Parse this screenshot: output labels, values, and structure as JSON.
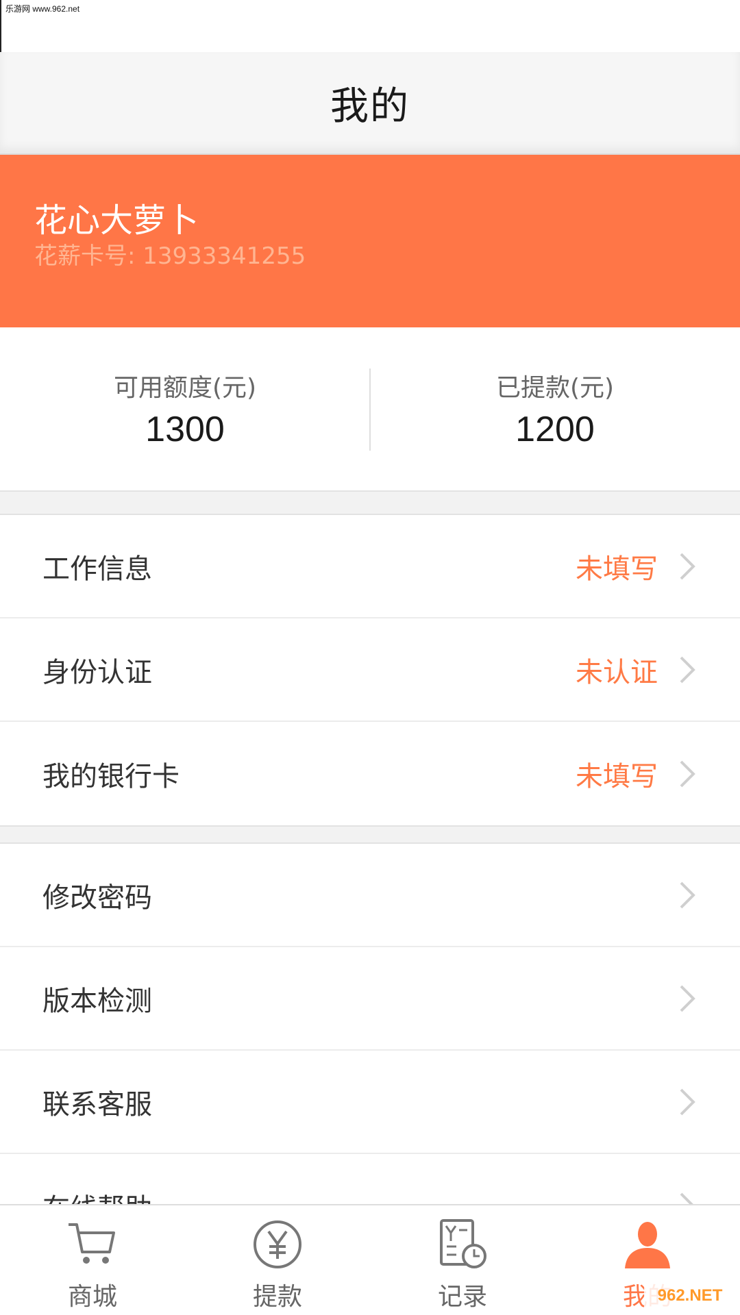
{
  "watermark": {
    "text": "乐游网 www.962.net"
  },
  "nav": {
    "title": "我的"
  },
  "profile": {
    "name": "花心大萝卜",
    "card": "花薪卡号: 13933341255"
  },
  "stats": [
    {
      "label": "可用额度(元)",
      "value": "1300"
    },
    {
      "label": "已提款(元)",
      "value": "1200"
    }
  ],
  "group1": [
    {
      "label": "工作信息",
      "status": "未填写"
    },
    {
      "label": "身份认证",
      "status": "未认证"
    },
    {
      "label": "我的银行卡",
      "status": "未填写"
    }
  ],
  "group2": [
    {
      "label": "修改密码"
    },
    {
      "label": "版本检测"
    },
    {
      "label": "联系客服"
    },
    {
      "label": "在线帮助"
    }
  ],
  "tabs": [
    {
      "label": "商城",
      "icon": "cart-icon"
    },
    {
      "label": "提款",
      "icon": "yen-icon"
    },
    {
      "label": "记录",
      "icon": "record-icon"
    },
    {
      "label": "我的",
      "icon": "user-icon",
      "active": true
    }
  ],
  "logo": {
    "text": "962.NET"
  },
  "colors": {
    "accent": "#ff7647",
    "status": "#ff7a45"
  }
}
